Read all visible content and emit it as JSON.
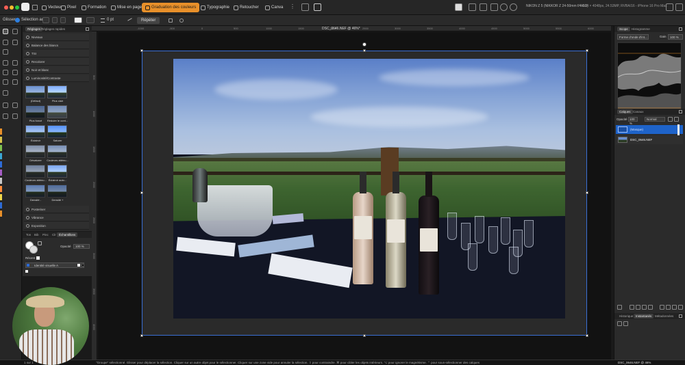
{
  "topbar": {
    "studios": [
      {
        "label": "Vecteur",
        "active": false
      },
      {
        "label": "Pixel",
        "active": false
      },
      {
        "label": "Formation",
        "active": false
      },
      {
        "label": "Mise en page",
        "active": false
      },
      {
        "label": "Graduation des couleurs",
        "active": true
      },
      {
        "label": "Typographie",
        "active": false
      },
      {
        "label": "Retoucher",
        "active": false
      },
      {
        "label": "Canva",
        "active": false
      }
    ],
    "camera_info": "NIKON Z 5 (NIKKOR Z 24-50mm f/4-6.3)",
    "doc_dims": "6064 × 4048px, 24.53MP, RVBA/16 - iPhone 16 Pro Max"
  },
  "context_toolbar": {
    "tool_label": "Glisser",
    "auto_select_label": "Sélection auto :",
    "stroke_width": "0 pt",
    "button_label": "Répéter"
  },
  "adjustments": {
    "tabs": [
      {
        "label": "Réglages",
        "active": true
      },
      {
        "label": "Réglages rapides",
        "active": false
      }
    ],
    "rows": [
      "Niveaux",
      "Balance des blancs",
      "TSI",
      "Recolorer",
      "Noir et blanc",
      "Luminosité/Contraste"
    ],
    "presets": [
      {
        "label": "(Défaut)"
      },
      {
        "label": "Plus clair"
      },
      {
        "label": "Plus foncé"
      },
      {
        "label": "Réduire le cont..."
      },
      {
        "label": "Éclaircir"
      },
      {
        "label": "Saturer"
      },
      {
        "label": "Désaturer"
      },
      {
        "label": "Couleurs atténu..."
      },
      {
        "label": "Couleurs atténu..."
      },
      {
        "label": "Éclaircir auto..."
      },
      {
        "label": "Densité -"
      },
      {
        "label": "Densité +"
      }
    ],
    "bottom_rows": [
      "Posteriser",
      "Vibrance",
      "Exposition"
    ]
  },
  "color_panel": {
    "tabs": [
      {
        "label": "Ton",
        "active": false
      },
      {
        "label": "Bib",
        "active": false
      },
      {
        "label": "Pinc",
        "active": false
      },
      {
        "label": "Clr",
        "active": false
      },
      {
        "label": "Échantillons",
        "active": true
      }
    ],
    "opacity_label": "Opacité",
    "opacity_value": "100 %",
    "recent_label": "Récent",
    "palette_name": "Identité visuelle A"
  },
  "canvas": {
    "doc_title": "DSC_0646.NEF @ 46%*",
    "ruler_h": [
      "-1000",
      "-500",
      "0",
      "500",
      "1000",
      "1500",
      "2000",
      "2500",
      "3000",
      "3500",
      "4000",
      "4500",
      "5000",
      "5500",
      "6000",
      "6500"
    ],
    "ruler_v": [
      "500",
      "1000",
      "1500",
      "2000",
      "2500",
      "3000",
      "3500",
      "4000"
    ]
  },
  "right_panel": {
    "top_tabs": [
      {
        "label": "Scope",
        "active": true
      },
      {
        "label": "Histogramme",
        "active": false
      }
    ],
    "scope_select": "Forme d'onde d'int...",
    "gain_label": "Gain",
    "gain_value": "100 %",
    "layer_tabs": [
      {
        "label": "Calques",
        "active": true
      },
      {
        "label": "Canaux",
        "active": false
      }
    ],
    "opacity_label": "Opacité",
    "opacity_value": "100 %",
    "blend_mode": "Normal",
    "layers": [
      {
        "name": "(Masque)",
        "selected": true
      },
      {
        "name": "DSC_0646.NEF",
        "selected": false
      }
    ],
    "bottom_tabs": [
      {
        "label": "Historique",
        "active": false
      },
      {
        "label": "Instantanés",
        "active": true
      },
      {
        "label": "Métadonnées",
        "active": false
      }
    ]
  },
  "statusbar": {
    "page": "1 sur 1",
    "hint": "\"Groupe\" sélectionné. Glisser pour déplacer la sélection. Cliquer sur un autre objet pour le sélectionner. Cliquer sur une zone vide pour annuler la sélection. ⇧ pour contraindre. ⌘ pour cibler les objets intérieurs. ⌥ pour ignorer le magnétisme. ⌃ pour sous-sélectionner des calques",
    "doc": "DSC_0646.NEF @ 46%"
  }
}
